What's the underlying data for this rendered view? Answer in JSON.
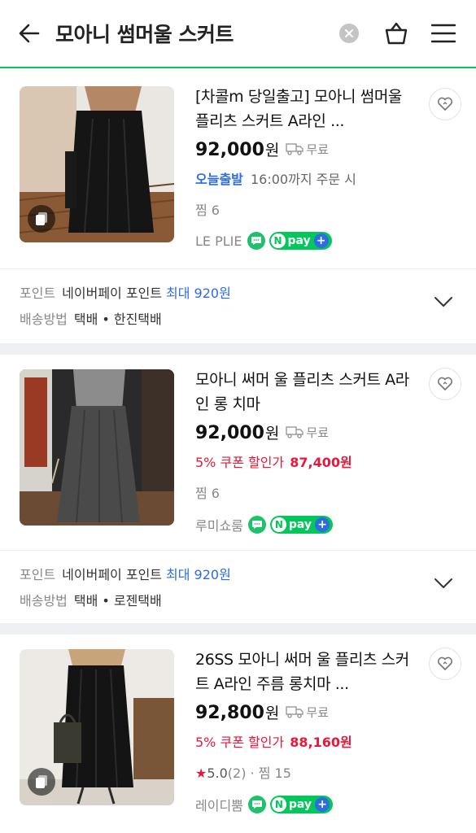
{
  "header": {
    "query": "모아니 썸머울 스커트"
  },
  "products": [
    {
      "title": "[차콜m 당일출고] 모아니 썸머울 플리츠 스커트 A라인 ...",
      "price": "92,000",
      "won": "원",
      "shipping": "무료",
      "extra_label": "오늘출발",
      "extra_text": "16:00까지 주문 시",
      "zzim": "찜 6",
      "seller": "LE PLIE"
    },
    {
      "title": "모아니 써머 울 플리츠 스커트 A라인 롱 치마",
      "price": "92,000",
      "won": "원",
      "shipping": "무료",
      "extra_label": "5% 쿠폰 할인가",
      "extra_price": "87,400원",
      "zzim": "찜 6",
      "seller": "루미쇼룸"
    },
    {
      "title": "26SS 모아니 써머 울 플리츠 스커트 A라인 주름 롱치마 ...",
      "price": "92,800",
      "won": "원",
      "shipping": "무료",
      "extra_label": "5% 쿠폰 할인가",
      "extra_price": "88,160원",
      "rating": "5.0",
      "reviews": "(2)",
      "zzim": "· 찜 15",
      "seller": "레이디뿜"
    }
  ],
  "subinfos": [
    {
      "point_label": "포인트",
      "point_value": "네이버페이 포인트",
      "point_max": "최대 920원",
      "delivery_label": "배송방법",
      "delivery_value": "택배",
      "delivery_carrier": "• 한진택배"
    },
    {
      "point_label": "포인트",
      "point_value": "네이버페이 포인트",
      "point_max": "최대 920원",
      "delivery_label": "배송방법",
      "delivery_value": "택배",
      "delivery_carrier": "• 로젠택배"
    }
  ],
  "npay_label": "pay",
  "npay_n": "N",
  "npay_plus": "+",
  "colors": {
    "accent_green": "#03c75a",
    "blue": "#2d6ce3",
    "red": "#e6193b"
  }
}
